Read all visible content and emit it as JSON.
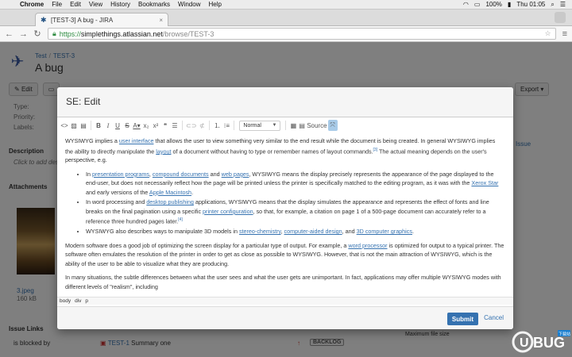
{
  "macbar": {
    "app": "Chrome",
    "menus": [
      "File",
      "Edit",
      "View",
      "History",
      "Bookmarks",
      "Window",
      "Help"
    ],
    "battery": "100%",
    "clock": "Thu 01:05"
  },
  "browser": {
    "tab_title": "[TEST-3] A bug - JIRA",
    "url_scheme": "https://",
    "url_host": "simplethings.atlassian.net",
    "url_path": "/browse/TEST-3"
  },
  "issue": {
    "project": "Test",
    "key": "TEST-3",
    "summary": "A bug",
    "edit_label": "Edit",
    "export_label": "Export",
    "fields": [
      "Type:",
      "Priority:",
      "Labels:"
    ],
    "description_heading": "Description",
    "description_placeholder": "Click to add des",
    "attachments_heading": "Attachments",
    "attachment_name": "3.jpeg",
    "attachment_size": "160 kB",
    "issue_links_heading": "Issue Links",
    "link_relation": "is blocked by",
    "link_key": "TEST-1",
    "link_summary": "Summary one",
    "link_status": "BACKLOG",
    "right_link": "Issue",
    "max_file_size": "Maximum file size"
  },
  "dialog": {
    "title": "SE: Edit",
    "format_select": "Normal",
    "source_label": "Source",
    "p1_a": "WYSIWYG implies a ",
    "p1_link1": "user interface",
    "p1_b": " that allows the user to view something very similar to the end result while the document is being created. In general WYSIWYG implies the ability to directly manipulate the ",
    "p1_link2": "layout",
    "p1_c": " of a document without having to type or remember names of layout commands.",
    "p1_sup": "[3]",
    "p1_d": " The actual meaning depends on the user's perspective, e.g.",
    "li1_a": "In ",
    "li1_l1": "presentation programs",
    "li1_b": ", ",
    "li1_l2": "compound documents",
    "li1_c": " and ",
    "li1_l3": "web pages",
    "li1_d": ", WYSIWYG means the display precisely represents the appearance of the page displayed to the end-user, but does not necessarily reflect how the page will be printed unless the printer is specifically matched to the editing program, as it was with the ",
    "li1_l4": "Xerox Star",
    "li1_e": " and early versions of the ",
    "li1_l5": "Apple Macintosh",
    "li1_f": ".",
    "li2_a": "In word processing and ",
    "li2_l1": "desktop publishing",
    "li2_b": " applications, WYSIWYG means that the display simulates the appearance and represents the effect of fonts and line breaks on the final pagination using a specific ",
    "li2_l2": "printer configuration",
    "li2_c": ", so that, for example, a citation on page 1 of a 500-page document can accurately refer to a reference three hundred pages later.",
    "li2_sup": "[4]",
    "li3_a": "WYSIWYG also describes ways to manipulate 3D models in ",
    "li3_l1": "stereo-chemistry",
    "li3_b": ", ",
    "li3_l2": "computer-aided design",
    "li3_c": ", and ",
    "li3_l3": "3D computer graphics",
    "li3_d": ".",
    "p2_a": "Modern software does a good job of optimizing the screen display for a particular type of output. For example, a ",
    "p2_link": "word processor",
    "p2_b": " is optimized for output to a typical printer. The software often emulates the resolution of the printer in order to get as close as possible to WYSIWYG. However, that is not the main attraction of WYSIWYG, which is the ability of the user to be able to visualize what they are producing.",
    "p3": "In many situations, the subtle differences between what the user sees and what the user gets are unimportant. In fact, applications may offer multiple WYSIWYG modes with different levels of \"realism\", including",
    "status_path": [
      "body",
      "div",
      "p"
    ],
    "submit_label": "Submit",
    "cancel_label": "Cancel"
  },
  "watermark": {
    "text": "UEBUG",
    "sub": "下载站"
  }
}
